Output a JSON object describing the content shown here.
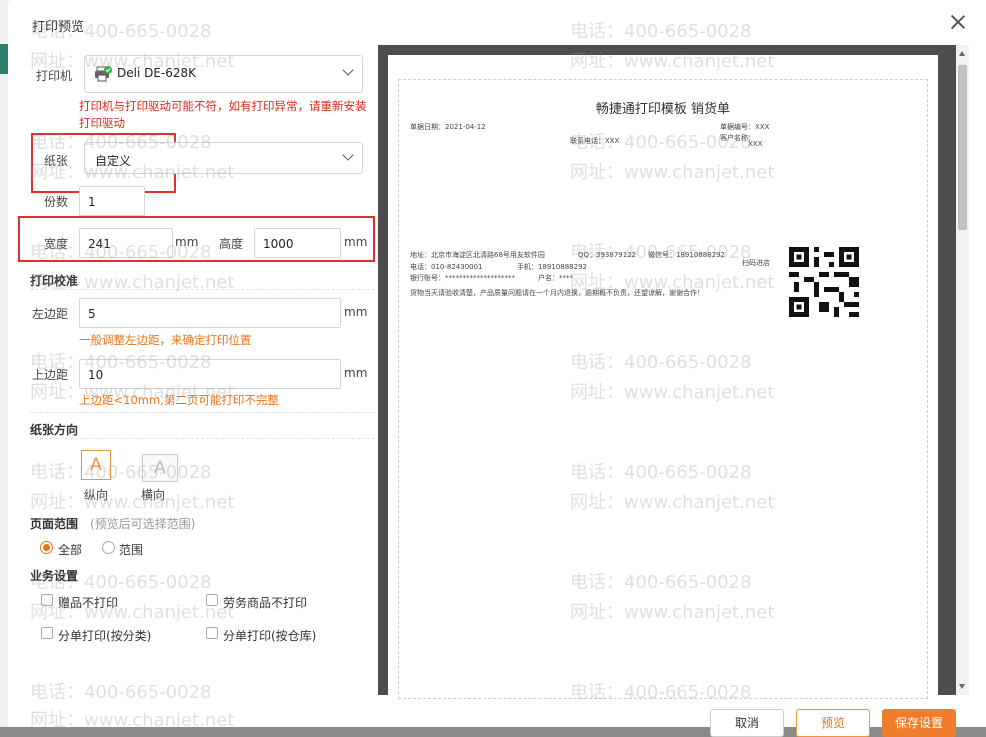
{
  "dialog": {
    "title": "打印预览"
  },
  "printer": {
    "label": "打印机",
    "value": "Deli DE-628K",
    "warning": "打印机与打印驱动可能不符，如有打印异常，请重新安装打印驱动"
  },
  "paper": {
    "label": "纸张",
    "value": "自定义"
  },
  "copies": {
    "label": "份数",
    "value": "1"
  },
  "size": {
    "width_label": "宽度",
    "width_value": "241",
    "width_unit": "mm",
    "height_label": "高度",
    "height_value": "1000",
    "height_unit": "mm"
  },
  "calibration": {
    "title": "打印校准",
    "left_label": "左边距",
    "left_value": "5",
    "left_unit": "mm",
    "left_hint": "一般调整左边距，来确定打印位置",
    "top_label": "上边距",
    "top_value": "10",
    "top_unit": "mm",
    "top_hint": "上边距<10mm,第二页可能打印不完整"
  },
  "orientation": {
    "title": "纸张方向",
    "portrait_glyph": "A",
    "portrait_label": "纵向",
    "landscape_glyph": "A",
    "landscape_label": "横向",
    "selected": "portrait"
  },
  "page_range": {
    "title": "页面范围",
    "note": "(预览后可选择范围)",
    "options": [
      {
        "label": "全部",
        "checked": true
      },
      {
        "label": "范围",
        "checked": false
      }
    ]
  },
  "business": {
    "title": "业务设置",
    "options": [
      "赠品不打印",
      "劳务商品不打印",
      "分单打印(按分类)",
      "分单打印(按仓库)"
    ]
  },
  "preview": {
    "title": "畅捷通打印模板 销货单",
    "date": "单据日期：2021-04-12",
    "doc_no": "单据编号：XXX",
    "contact": "联系电话：XXX",
    "r2a": "客户名称：",
    "r2b": "XXX",
    "address": "地址：北京市海淀区北清路68号用友软件园",
    "qq": "QQ：393879122",
    "wechat": "微信号：18910888292",
    "phone": "电话：010-82430001",
    "mobile": "手机：18910888292",
    "bank": "银行账号：********************",
    "product": "户名：****",
    "scan": "扫码进店",
    "note": "货物当天请验收清楚，产品质量问题请在一个月内退换，逾期概不负责，还望谅解，谢谢合作！"
  },
  "buttons": {
    "cancel": "取消",
    "preview": "预览",
    "save": "保存设置"
  },
  "watermark": {
    "line1": "电话：400-665-0028",
    "line2": "网址：www.chanjet.net"
  },
  "colors": {
    "accent": "#f07d2c",
    "highlight": "#e0302a",
    "warning": "#d9281c",
    "hint": "#e8741a"
  }
}
